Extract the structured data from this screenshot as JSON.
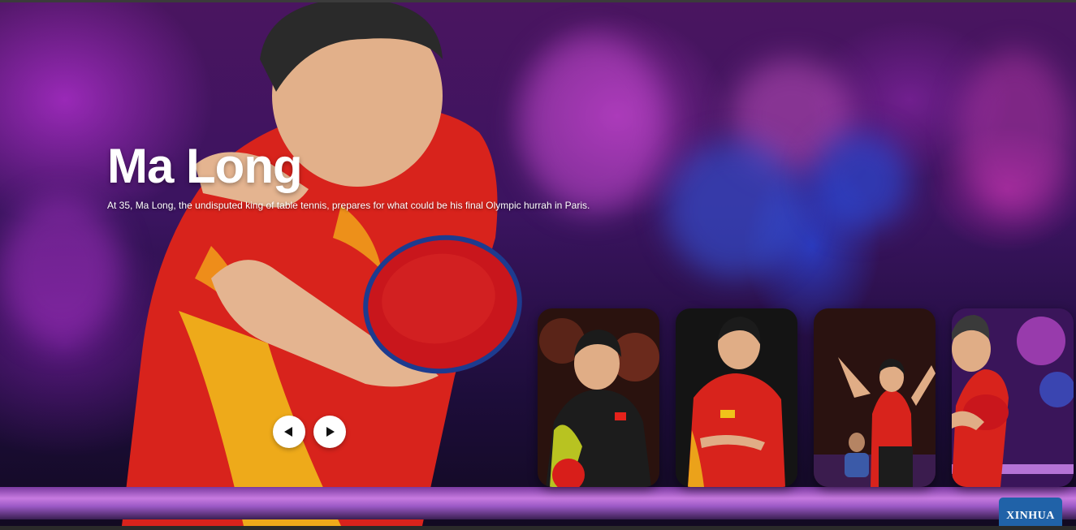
{
  "hero": {
    "title": "Ma Long",
    "subtitle": "At 35, Ma Long, the undisputed king of table tennis, prepares for what could be his final Olympic hurrah in Paris.",
    "image_subject": "player-forehand-red-jersey"
  },
  "navigation": {
    "prev_icon": "triangle-left-icon",
    "next_icon": "triangle-right-icon"
  },
  "thumbnails": [
    {
      "id": "thumb-1",
      "subject": "player-black-jersey"
    },
    {
      "id": "thumb-2",
      "subject": "player-red-jersey"
    },
    {
      "id": "thumb-3",
      "subject": "player-celebrating"
    },
    {
      "id": "thumb-4",
      "subject": "ma-long-forehand"
    }
  ],
  "watermark": {
    "text": "XINHUA"
  },
  "colors": {
    "accent_purple": "#8a2fbf",
    "jersey_red": "#d8231c",
    "button_bg": "#ffffff",
    "badge_blue": "#2062a8"
  }
}
